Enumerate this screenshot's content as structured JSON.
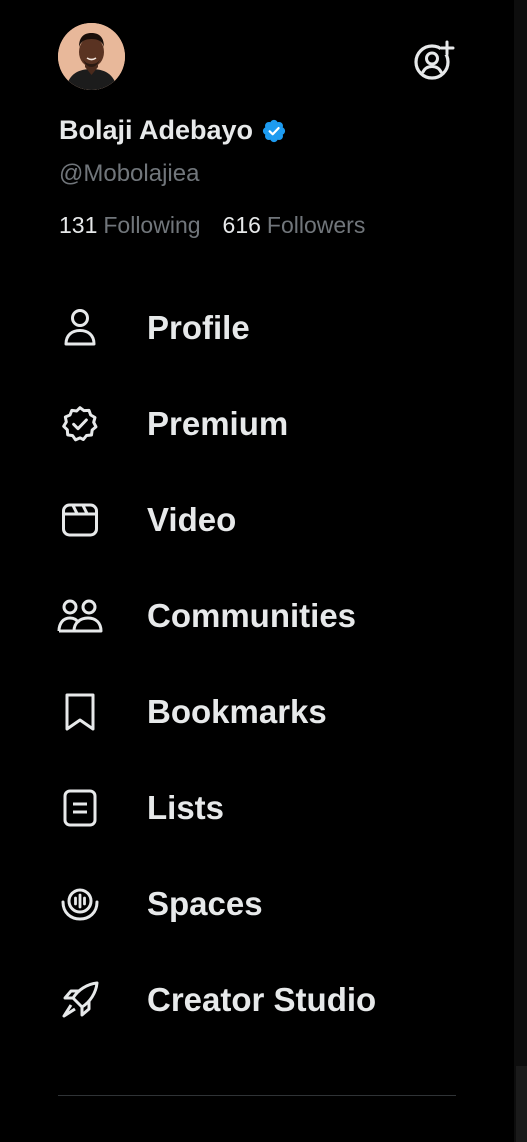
{
  "colors": {
    "background": "#000000",
    "text_primary": "#e7e9ea",
    "text_secondary": "#71767b",
    "verified_blue": "#1d9bf0",
    "divider": "#2f3336"
  },
  "header": {
    "avatar_icon": "user-avatar-photo",
    "add_account_icon": "add-account-icon"
  },
  "profile": {
    "display_name": "Bolaji Adebayo",
    "verified_icon": "verified-badge-icon",
    "handle": "@Mobolajiea",
    "following_count": "131",
    "following_label": "Following",
    "followers_count": "616",
    "followers_label": "Followers"
  },
  "menu": {
    "items": [
      {
        "label": "Profile",
        "icon": "person-icon"
      },
      {
        "label": "Premium",
        "icon": "premium-badge-icon"
      },
      {
        "label": "Video",
        "icon": "video-clapper-icon"
      },
      {
        "label": "Communities",
        "icon": "communities-icon"
      },
      {
        "label": "Bookmarks",
        "icon": "bookmark-icon"
      },
      {
        "label": "Lists",
        "icon": "list-icon"
      },
      {
        "label": "Spaces",
        "icon": "spaces-icon"
      },
      {
        "label": "Creator Studio",
        "icon": "rocket-icon"
      }
    ]
  }
}
